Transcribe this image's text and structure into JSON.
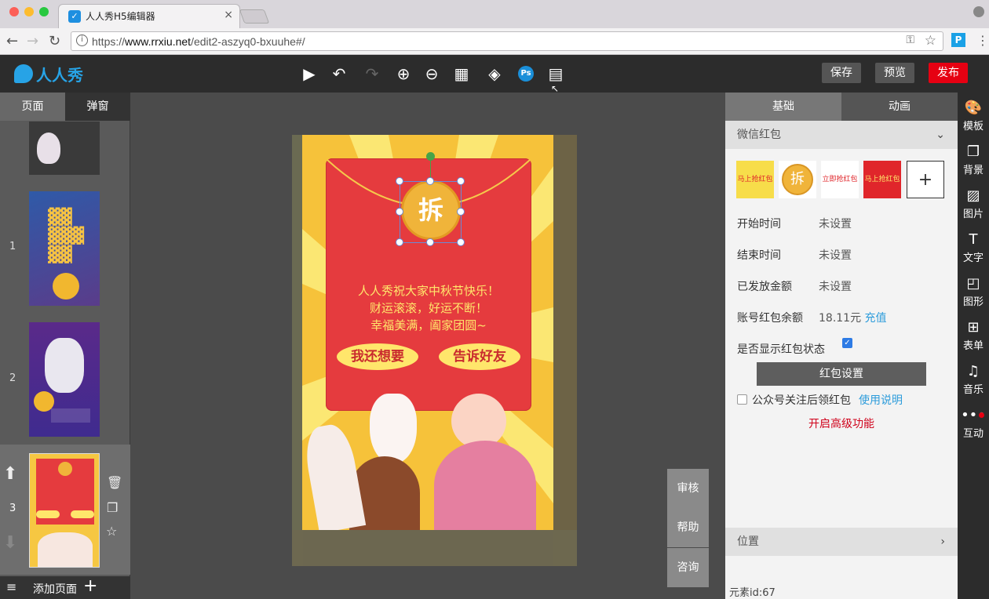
{
  "browser": {
    "tab_title": "人人秀H5编辑器",
    "tab_close": "×",
    "url_prefix": "https://",
    "url_host": "www.rrxiu.net",
    "url_path": "/edit2-aszyq0-bxuuhe#/",
    "ext_label": "P"
  },
  "header": {
    "logo_text": "人人秀",
    "save_label": "保存",
    "preview_label": "预览",
    "publish_label": "发布",
    "ps_label": "Ps"
  },
  "left_panel": {
    "tabs": [
      {
        "label": "页面"
      },
      {
        "label": "弹窗"
      }
    ],
    "pages": [
      {
        "num": "1"
      },
      {
        "num": "2"
      },
      {
        "num": "3"
      }
    ],
    "footer_label": "添加页面"
  },
  "canvas": {
    "greeting_lines": [
      "人人秀祝大家中秋节快乐！",
      "财运滚滚，好运不断！",
      "幸福美满，阖家团圆~"
    ],
    "button_left": "我还想要",
    "button_right": "告诉好友",
    "coin_char": "拆",
    "side_buttons": [
      {
        "label": "审核"
      },
      {
        "label": "帮助"
      },
      {
        "label": "咨询"
      }
    ],
    "colors": {
      "red_packet": "#e53b3e",
      "gold": "#f0b43a",
      "text_yellow": "#ffe66b"
    }
  },
  "right_panel": {
    "tabs": [
      {
        "label": "基础"
      },
      {
        "label": "动画"
      }
    ],
    "section_title": "微信红包",
    "packet_options": [
      {
        "label": "马上抢红包"
      },
      {
        "label": "拆"
      },
      {
        "label": "立即抢红包"
      },
      {
        "label": "马上抢红包"
      },
      {
        "label": "+"
      }
    ],
    "fields": [
      {
        "label": "开始时间",
        "value": "未设置"
      },
      {
        "label": "结束时间",
        "value": "未设置"
      },
      {
        "label": "已发放金额",
        "value": "未设置"
      },
      {
        "label": "账号红包余额",
        "value": "18.11元",
        "link": "充值"
      }
    ],
    "show_status_label": "是否显示红包状态",
    "show_status_checked": true,
    "settings_button": "红包设置",
    "follow_label": "公众号关注后领红包",
    "follow_checked": false,
    "usage_link": "使用说明",
    "advanced_link": "开启高级功能",
    "position_title": "位置",
    "element_id": "元素id:67"
  },
  "right_strip": [
    {
      "icon": "palette-icon",
      "label": "模板"
    },
    {
      "icon": "background-icon",
      "label": "背景"
    },
    {
      "icon": "image-icon",
      "label": "图片"
    },
    {
      "icon": "text-icon",
      "label": "文字"
    },
    {
      "icon": "shape-icon",
      "label": "图形"
    },
    {
      "icon": "form-icon",
      "label": "表单"
    },
    {
      "icon": "music-icon",
      "label": "音乐"
    },
    {
      "icon": "more-icon",
      "label": "互动"
    }
  ]
}
